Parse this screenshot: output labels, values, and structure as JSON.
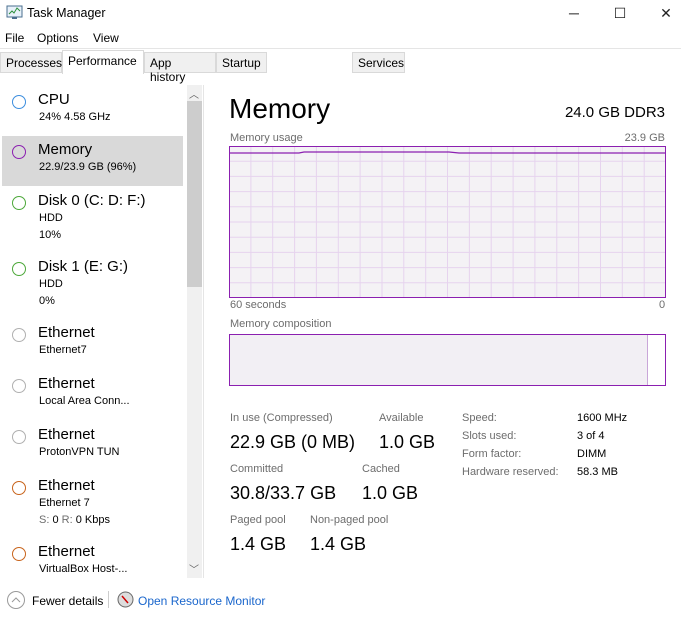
{
  "window": {
    "title": "Task Manager",
    "minimize": "─",
    "maximize": "☐",
    "close": "✕"
  },
  "menu": [
    "File",
    "Options",
    "View"
  ],
  "tabs": [
    "Processes",
    "Performance",
    "App history",
    "Startup",
    "Services"
  ],
  "sidebar": [
    {
      "title": "CPU",
      "sub1": "24% 4.58 GHz",
      "color": "#3c8ede"
    },
    {
      "title": "Memory",
      "sub1": "22.9/23.9 GB (96%)",
      "color": "#8b1fb0"
    },
    {
      "title": "Disk 0 (C: D: F:)",
      "sub1": "HDD",
      "sub2": "10%",
      "color": "#4da83a"
    },
    {
      "title": "Disk 1 (E: G:)",
      "sub1": "HDD",
      "sub2": "0%",
      "color": "#4da83a"
    },
    {
      "title": "Ethernet",
      "sub1": "Ethernet7",
      "color": "#b0b0b0"
    },
    {
      "title": "Ethernet",
      "sub1": "Local Area Conn...",
      "color": "#b0b0b0"
    },
    {
      "title": "Ethernet",
      "sub1": "ProtonVPN TUN",
      "color": "#b0b0b0"
    },
    {
      "title": "Ethernet",
      "sub1": "Ethernet 7",
      "sub2a": "S:",
      "sub2b": "0",
      "sub2c": "R:",
      "sub2d": "0 Kbps",
      "color": "#c8641c"
    },
    {
      "title": "Ethernet",
      "sub1": "VirtualBox Host-...",
      "color": "#c8641c"
    }
  ],
  "main": {
    "title": "Memory",
    "spec": "24.0 GB DDR3",
    "usage_label": "Memory usage",
    "usage_max": "23.9 GB",
    "time_left": "60 seconds",
    "time_right": "0",
    "composition_label": "Memory composition",
    "in_use_fraction": 0.96,
    "accent": "#8b1fb0",
    "stats": {
      "in_use_label": "In use (Compressed)",
      "in_use": "22.9 GB (0 MB)",
      "available_label": "Available",
      "available": "1.0 GB",
      "committed_label": "Committed",
      "committed": "30.8/33.7 GB",
      "cached_label": "Cached",
      "cached": "1.0 GB",
      "paged_label": "Paged pool",
      "paged": "1.4 GB",
      "nonpaged_label": "Non-paged pool",
      "nonpaged": "1.4 GB"
    },
    "specs": [
      {
        "k": "Speed:",
        "v": "1600 MHz"
      },
      {
        "k": "Slots used:",
        "v": "3 of 4"
      },
      {
        "k": "Form factor:",
        "v": "DIMM"
      },
      {
        "k": "Hardware reserved:",
        "v": "58.3 MB"
      }
    ]
  },
  "footer": {
    "fewer": "Fewer details",
    "monitor": "Open Resource Monitor"
  }
}
